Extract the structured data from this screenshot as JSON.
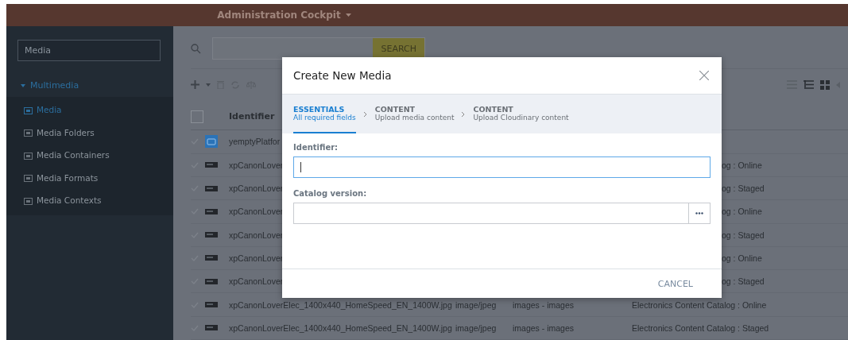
{
  "header": {
    "title": "Administration Cockpit"
  },
  "sidebar": {
    "search": {
      "value": "Media"
    },
    "groups": [
      {
        "label": "Multimedia",
        "expanded": true,
        "children": [
          {
            "label": "Media",
            "selected": true
          },
          {
            "label": "Media Folders",
            "selected": false
          },
          {
            "label": "Media Containers",
            "selected": false
          },
          {
            "label": "Media Formats",
            "selected": false
          },
          {
            "label": "Media Contexts",
            "selected": false
          }
        ]
      }
    ]
  },
  "search": {
    "button": "SEARCH"
  },
  "table": {
    "select_all_checked": false,
    "columns": [
      "Identifier"
    ],
    "rows": [
      {
        "kind": "partial",
        "thumbnail": {
          "kind": "generic"
        },
        "identifier": "yemptyPlatfor"
      },
      {
        "kind": "partial",
        "thumbnail": {
          "kind": "image"
        },
        "identifier": "xpCanonLover",
        "catalog": "og : Online"
      },
      {
        "kind": "partial",
        "thumbnail": {
          "kind": "image"
        },
        "identifier": "xpCanonLover",
        "catalog": "og : Staged"
      },
      {
        "kind": "partial",
        "thumbnail": {
          "kind": "image"
        },
        "identifier": "xpCanonLover",
        "catalog": "og : Online"
      },
      {
        "kind": "partial",
        "thumbnail": {
          "kind": "image"
        },
        "identifier": "xpCanonLover",
        "catalog": "og : Staged"
      },
      {
        "kind": "partial",
        "thumbnail": {
          "kind": "image"
        },
        "identifier": "xpCanonLover",
        "catalog": "og : Online"
      },
      {
        "kind": "partial",
        "thumbnail": {
          "kind": "image"
        },
        "identifier": "xpCanonLover",
        "catalog": "og : Staged"
      },
      {
        "kind": "full",
        "thumbnail": {
          "kind": "image"
        },
        "identifier": "xpCanonLoverElec_1400x440_HomeSpeed_EN_1400W.jpg",
        "mime": "image/jpeg",
        "folder": "images - images",
        "catalog": "Electronics Content Catalog : Online"
      },
      {
        "kind": "full",
        "thumbnail": {
          "kind": "image"
        },
        "identifier": "xpCanonLoverElec_1400x440_HomeSpeed_EN_1400W.jpg",
        "mime": "image/jpeg",
        "folder": "images - images",
        "catalog": "Electronics Content Catalog : Staged"
      }
    ]
  },
  "dialog": {
    "title": "Create New Media",
    "steps": [
      {
        "title": "ESSENTIALS",
        "subtitle": "All required fields",
        "selected": true
      },
      {
        "title": "CONTENT",
        "subtitle": "Upload media content",
        "selected": false
      },
      {
        "title": "CONTENT",
        "subtitle": "Upload Cloudinary content",
        "selected": false
      }
    ],
    "fields": [
      {
        "kind": "text",
        "label": "Identifier:",
        "focused": true
      },
      {
        "kind": "reference",
        "label": "Catalog version:",
        "focused": false
      }
    ],
    "footer": {
      "button": "CANCEL"
    }
  }
}
